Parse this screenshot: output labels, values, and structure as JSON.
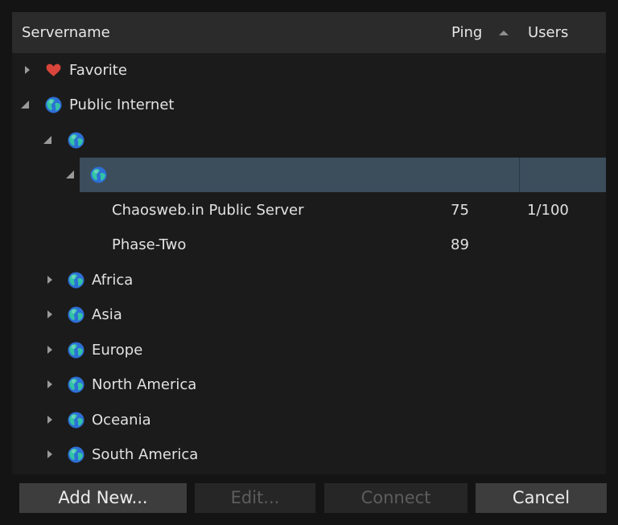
{
  "header": {
    "servername": "Servername",
    "ping": "Ping",
    "users": "Users",
    "sort_icon": "sort-ascending-icon"
  },
  "tree": {
    "favorite": {
      "label": "Favorite",
      "icon": "heart-icon",
      "expanded": false
    },
    "public_internet": {
      "label": "Public Internet",
      "icon": "globe-icon",
      "expanded": true
    },
    "unnamed_group": {
      "label": "",
      "icon": "globe-icon",
      "expanded": true
    },
    "unnamed_subgroup": {
      "label": "",
      "icon": "globe-icon",
      "expanded": true,
      "selected": true
    },
    "servers": [
      {
        "name": "Chaosweb.in Public Server",
        "ping": "75",
        "users": "1/100"
      },
      {
        "name": "Phase-Two",
        "ping": "89",
        "users": ""
      }
    ],
    "regions": [
      {
        "label": "Africa",
        "icon": "globe-icon",
        "expanded": false
      },
      {
        "label": "Asia",
        "icon": "globe-icon",
        "expanded": false
      },
      {
        "label": "Europe",
        "icon": "globe-icon",
        "expanded": false
      },
      {
        "label": "North America",
        "icon": "globe-icon",
        "expanded": false
      },
      {
        "label": "Oceania",
        "icon": "globe-icon",
        "expanded": false
      },
      {
        "label": "South America",
        "icon": "globe-icon",
        "expanded": false
      }
    ]
  },
  "buttons": {
    "add_new": "Add New...",
    "edit": "Edit...",
    "connect": "Connect",
    "cancel": "Cancel"
  },
  "colors": {
    "selection": "#3c4d5c",
    "heart": "#d9453b",
    "globe_land": "#2fb8a8",
    "globe_sea": "#2d6fd6"
  }
}
